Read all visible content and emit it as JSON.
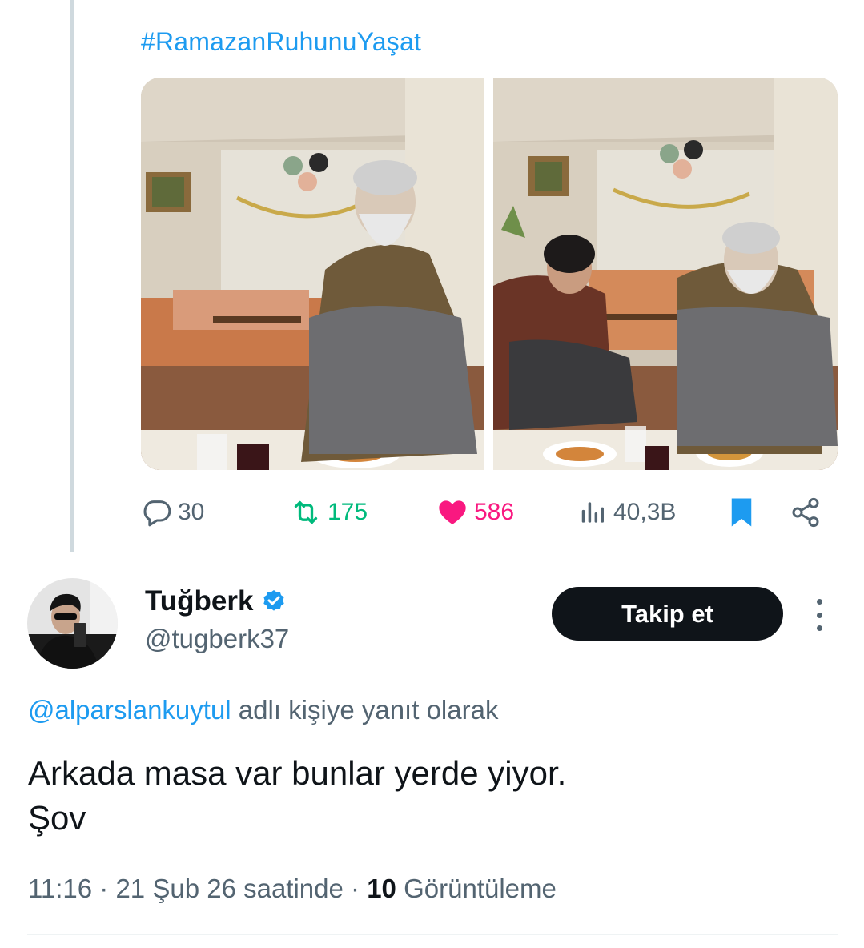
{
  "quoted_tweet": {
    "hashtag": "#RamazanRuhunuYaşat",
    "images": [
      {
        "alt": "Photo: man eating iftar on the floor"
      },
      {
        "alt": "Photo: two people eating iftar on the floor"
      }
    ],
    "actions": {
      "replies": "30",
      "retweets": "175",
      "likes": "586",
      "views": "40,3B"
    }
  },
  "reply": {
    "author": {
      "name": "Tuğberk",
      "handle": "@tugberk37",
      "verified": true
    },
    "follow_label": "Takip et",
    "replying_to": {
      "mention": "@alparslankuytul",
      "suffix": "adlı kişiye yanıt olarak"
    },
    "text_lines": [
      "Arkada masa var bunlar yerde yiyor.",
      "Şov"
    ],
    "meta": {
      "time_date": "11:16 · 21 Şub 26 saatinde ·",
      "views_count": "10",
      "views_label": "Görüntüleme"
    }
  },
  "colors": {
    "accent": "#1d9bf0",
    "retweet": "#00ba7c",
    "like": "#f91880",
    "text": "#0f1419",
    "secondary": "#536471"
  },
  "icons": [
    "reply-icon",
    "retweet-icon",
    "heart-icon",
    "views-icon",
    "bookmark-icon",
    "share-icon",
    "verified-badge-icon",
    "more-options-icon"
  ]
}
